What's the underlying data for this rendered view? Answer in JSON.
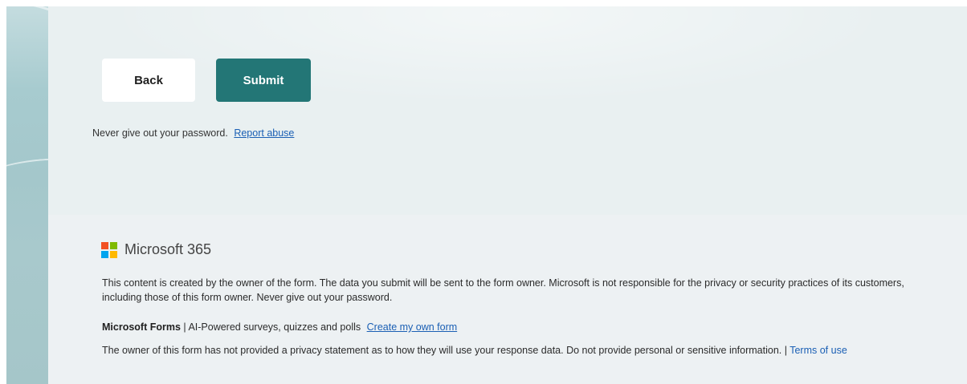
{
  "actions": {
    "back_label": "Back",
    "submit_label": "Submit"
  },
  "security_note": {
    "text": "Never give out your password.",
    "report_link": "Report abuse"
  },
  "brand": {
    "name": "Microsoft 365",
    "logo_colors": [
      "#f25022",
      "#7fba00",
      "#00a4ef",
      "#ffb900"
    ]
  },
  "footer": {
    "disclaimer": "This content is created by the owner of the form. The data you submit will be sent to the form owner. Microsoft is not responsible for the privacy or security practices of its customers, including those of this form owner. Never give out your password.",
    "product_name": "Microsoft Forms",
    "product_tagline": " | AI-Powered surveys, quizzes and polls",
    "create_link": "Create my own form",
    "privacy_text": "The owner of this form has not provided a privacy statement as to how they will use your response data. Do not provide personal or sensitive information. | ",
    "terms_link": "Terms of use"
  },
  "colors": {
    "accent": "#237676",
    "link": "#1a5fb4",
    "background": "#e9f0f1"
  }
}
